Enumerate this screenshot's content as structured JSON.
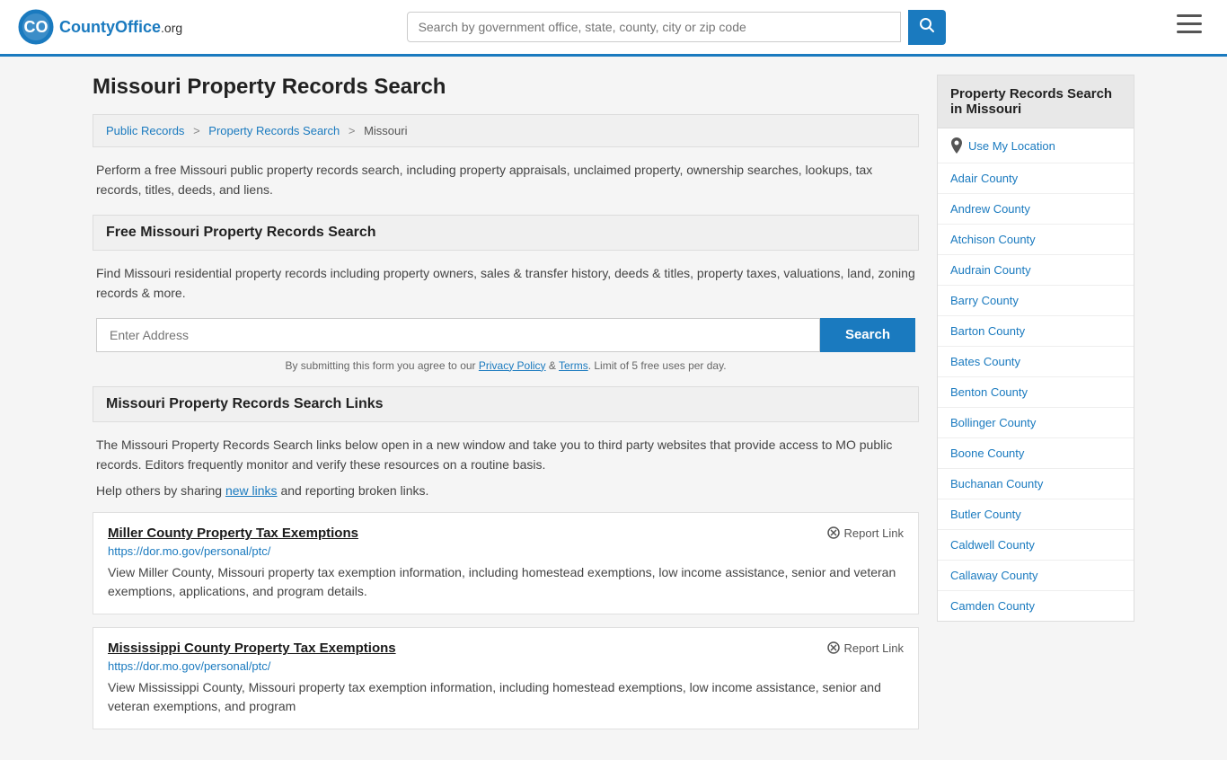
{
  "header": {
    "logo_text": "CountyOffice",
    "logo_suffix": ".org",
    "search_placeholder": "Search by government office, state, county, city or zip code"
  },
  "page": {
    "title": "Missouri Property Records Search",
    "breadcrumb": {
      "items": [
        "Public Records",
        "Property Records Search",
        "Missouri"
      ]
    },
    "description": "Perform a free Missouri public property records search, including property appraisals, unclaimed property, ownership searches, lookups, tax records, titles, deeds, and liens.",
    "free_search_section": {
      "heading": "Free Missouri Property Records Search",
      "description": "Find Missouri residential property records including property owners, sales & transfer history, deeds & titles, property taxes, valuations, land, zoning records & more.",
      "search_placeholder": "Enter Address",
      "search_button": "Search",
      "disclaimer_prefix": "By submitting this form you agree to our ",
      "privacy_label": "Privacy Policy",
      "disclaimer_mid": " & ",
      "terms_label": "Terms",
      "disclaimer_suffix": ". Limit of 5 free uses per day."
    },
    "links_section": {
      "heading": "Missouri Property Records Search Links",
      "description": "The Missouri Property Records Search links below open in a new window and take you to third party websites that provide access to MO public records. Editors frequently monitor and verify these resources on a routine basis.",
      "help_text_prefix": "Help others by sharing ",
      "new_links_label": "new links",
      "help_text_suffix": " and reporting broken links.",
      "links": [
        {
          "title": "Miller County Property Tax Exemptions",
          "url": "https://dor.mo.gov/personal/ptc/",
          "description": "View Miller County, Missouri property tax exemption information, including homestead exemptions, low income assistance, senior and veteran exemptions, applications, and program details.",
          "report_label": "Report Link"
        },
        {
          "title": "Mississippi County Property Tax Exemptions",
          "url": "https://dor.mo.gov/personal/ptc/",
          "description": "View Mississippi County, Missouri property tax exemption information, including homestead exemptions, low income assistance, senior and veteran exemptions, and program",
          "report_label": "Report Link"
        }
      ]
    }
  },
  "sidebar": {
    "heading": "Property Records Search in Missouri",
    "use_my_location": "Use My Location",
    "counties": [
      "Adair County",
      "Andrew County",
      "Atchison County",
      "Audrain County",
      "Barry County",
      "Barton County",
      "Bates County",
      "Benton County",
      "Bollinger County",
      "Boone County",
      "Buchanan County",
      "Butler County",
      "Caldwell County",
      "Callaway County",
      "Camden County"
    ]
  }
}
